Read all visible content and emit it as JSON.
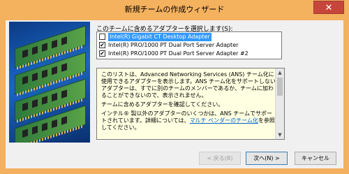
{
  "window": {
    "title": "新規チームの作成ウィザード",
    "close_glyph": "✕"
  },
  "instruction": "このチームに含めるアダプターを選択します(S):",
  "adapters": [
    {
      "label": "Intel(R) Gigabit CT Desktop Adapter",
      "checked": false,
      "selected": true
    },
    {
      "label": "Intel(R) PRO/1000 PT Dual Port Server Adapter",
      "checked": true,
      "selected": false
    },
    {
      "label": "Intel(R) PRO/1000 PT Dual Port Server Adapter #2",
      "checked": true,
      "selected": false
    }
  ],
  "info": {
    "p1": "このリストは、Advanced Networking Services (ANS) チーム化に使用できるアダプターを表示します。ANS チーム化をサポートしないアダプターは、すでに別のチームのメンバーであるか、チームに加わることができないので、表示されません。",
    "p2": "チームに含めるアダプターを確認してください。",
    "p3_pre": "インテル® 製以外のアダプターのいくつかは、ANS チームでサポートされています。詳細については、",
    "p3_link": "マルチ ベンダーのチーム化",
    "p3_post": "を参照してください。"
  },
  "buttons": {
    "back": "< 戻る(B)",
    "next": "次へ(N) >",
    "cancel": "キャンセル"
  }
}
